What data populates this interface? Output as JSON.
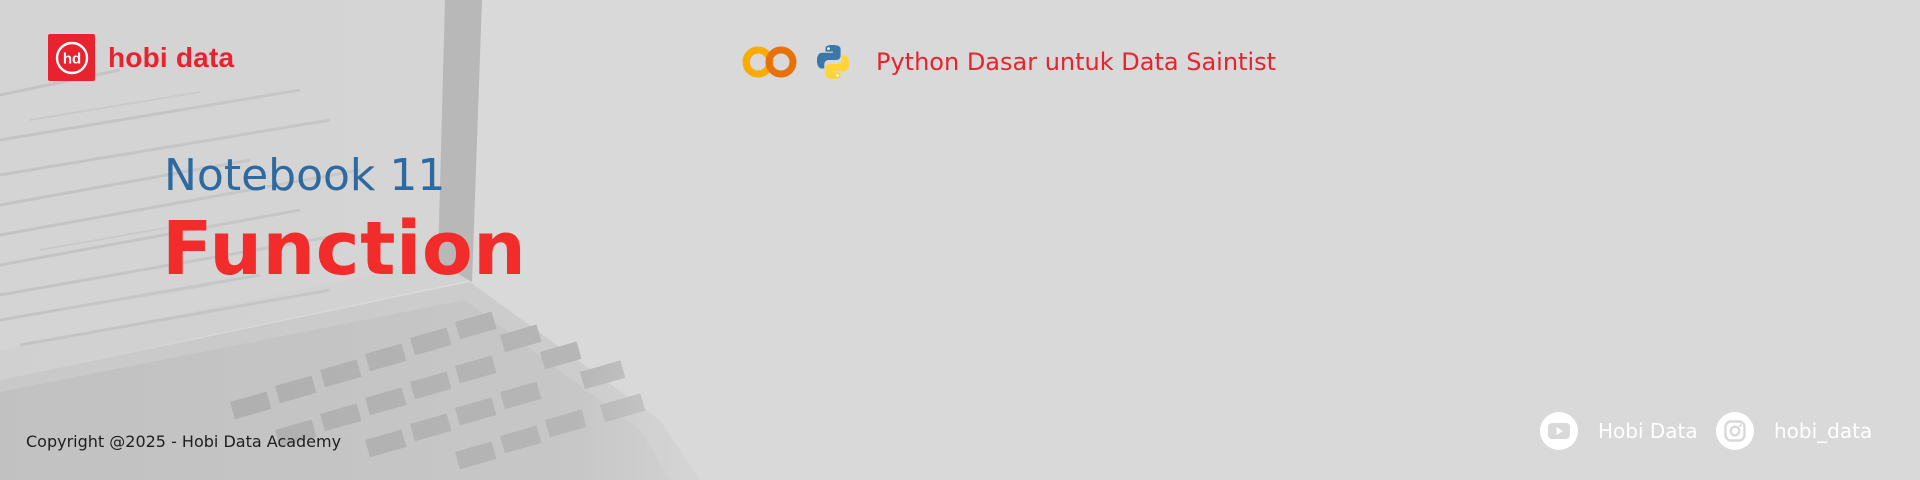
{
  "brand": {
    "logo_mark_text": "hd",
    "name": "hobi data",
    "color": "#e8232f"
  },
  "course": {
    "icons": [
      "colab-icon",
      "python-icon"
    ],
    "title": "Python Dasar untuk Data Saintist"
  },
  "notebook": {
    "label": "Notebook 11",
    "title": "Function",
    "label_color": "#2e6aa0",
    "title_color": "#f22b2b"
  },
  "footer": {
    "copyright": "Copyright @2025 - Hobi Data Academy",
    "youtube": {
      "icon": "youtube-icon",
      "label": "Hobi Data"
    },
    "instagram": {
      "icon": "instagram-icon",
      "label": "hobi_data"
    }
  }
}
